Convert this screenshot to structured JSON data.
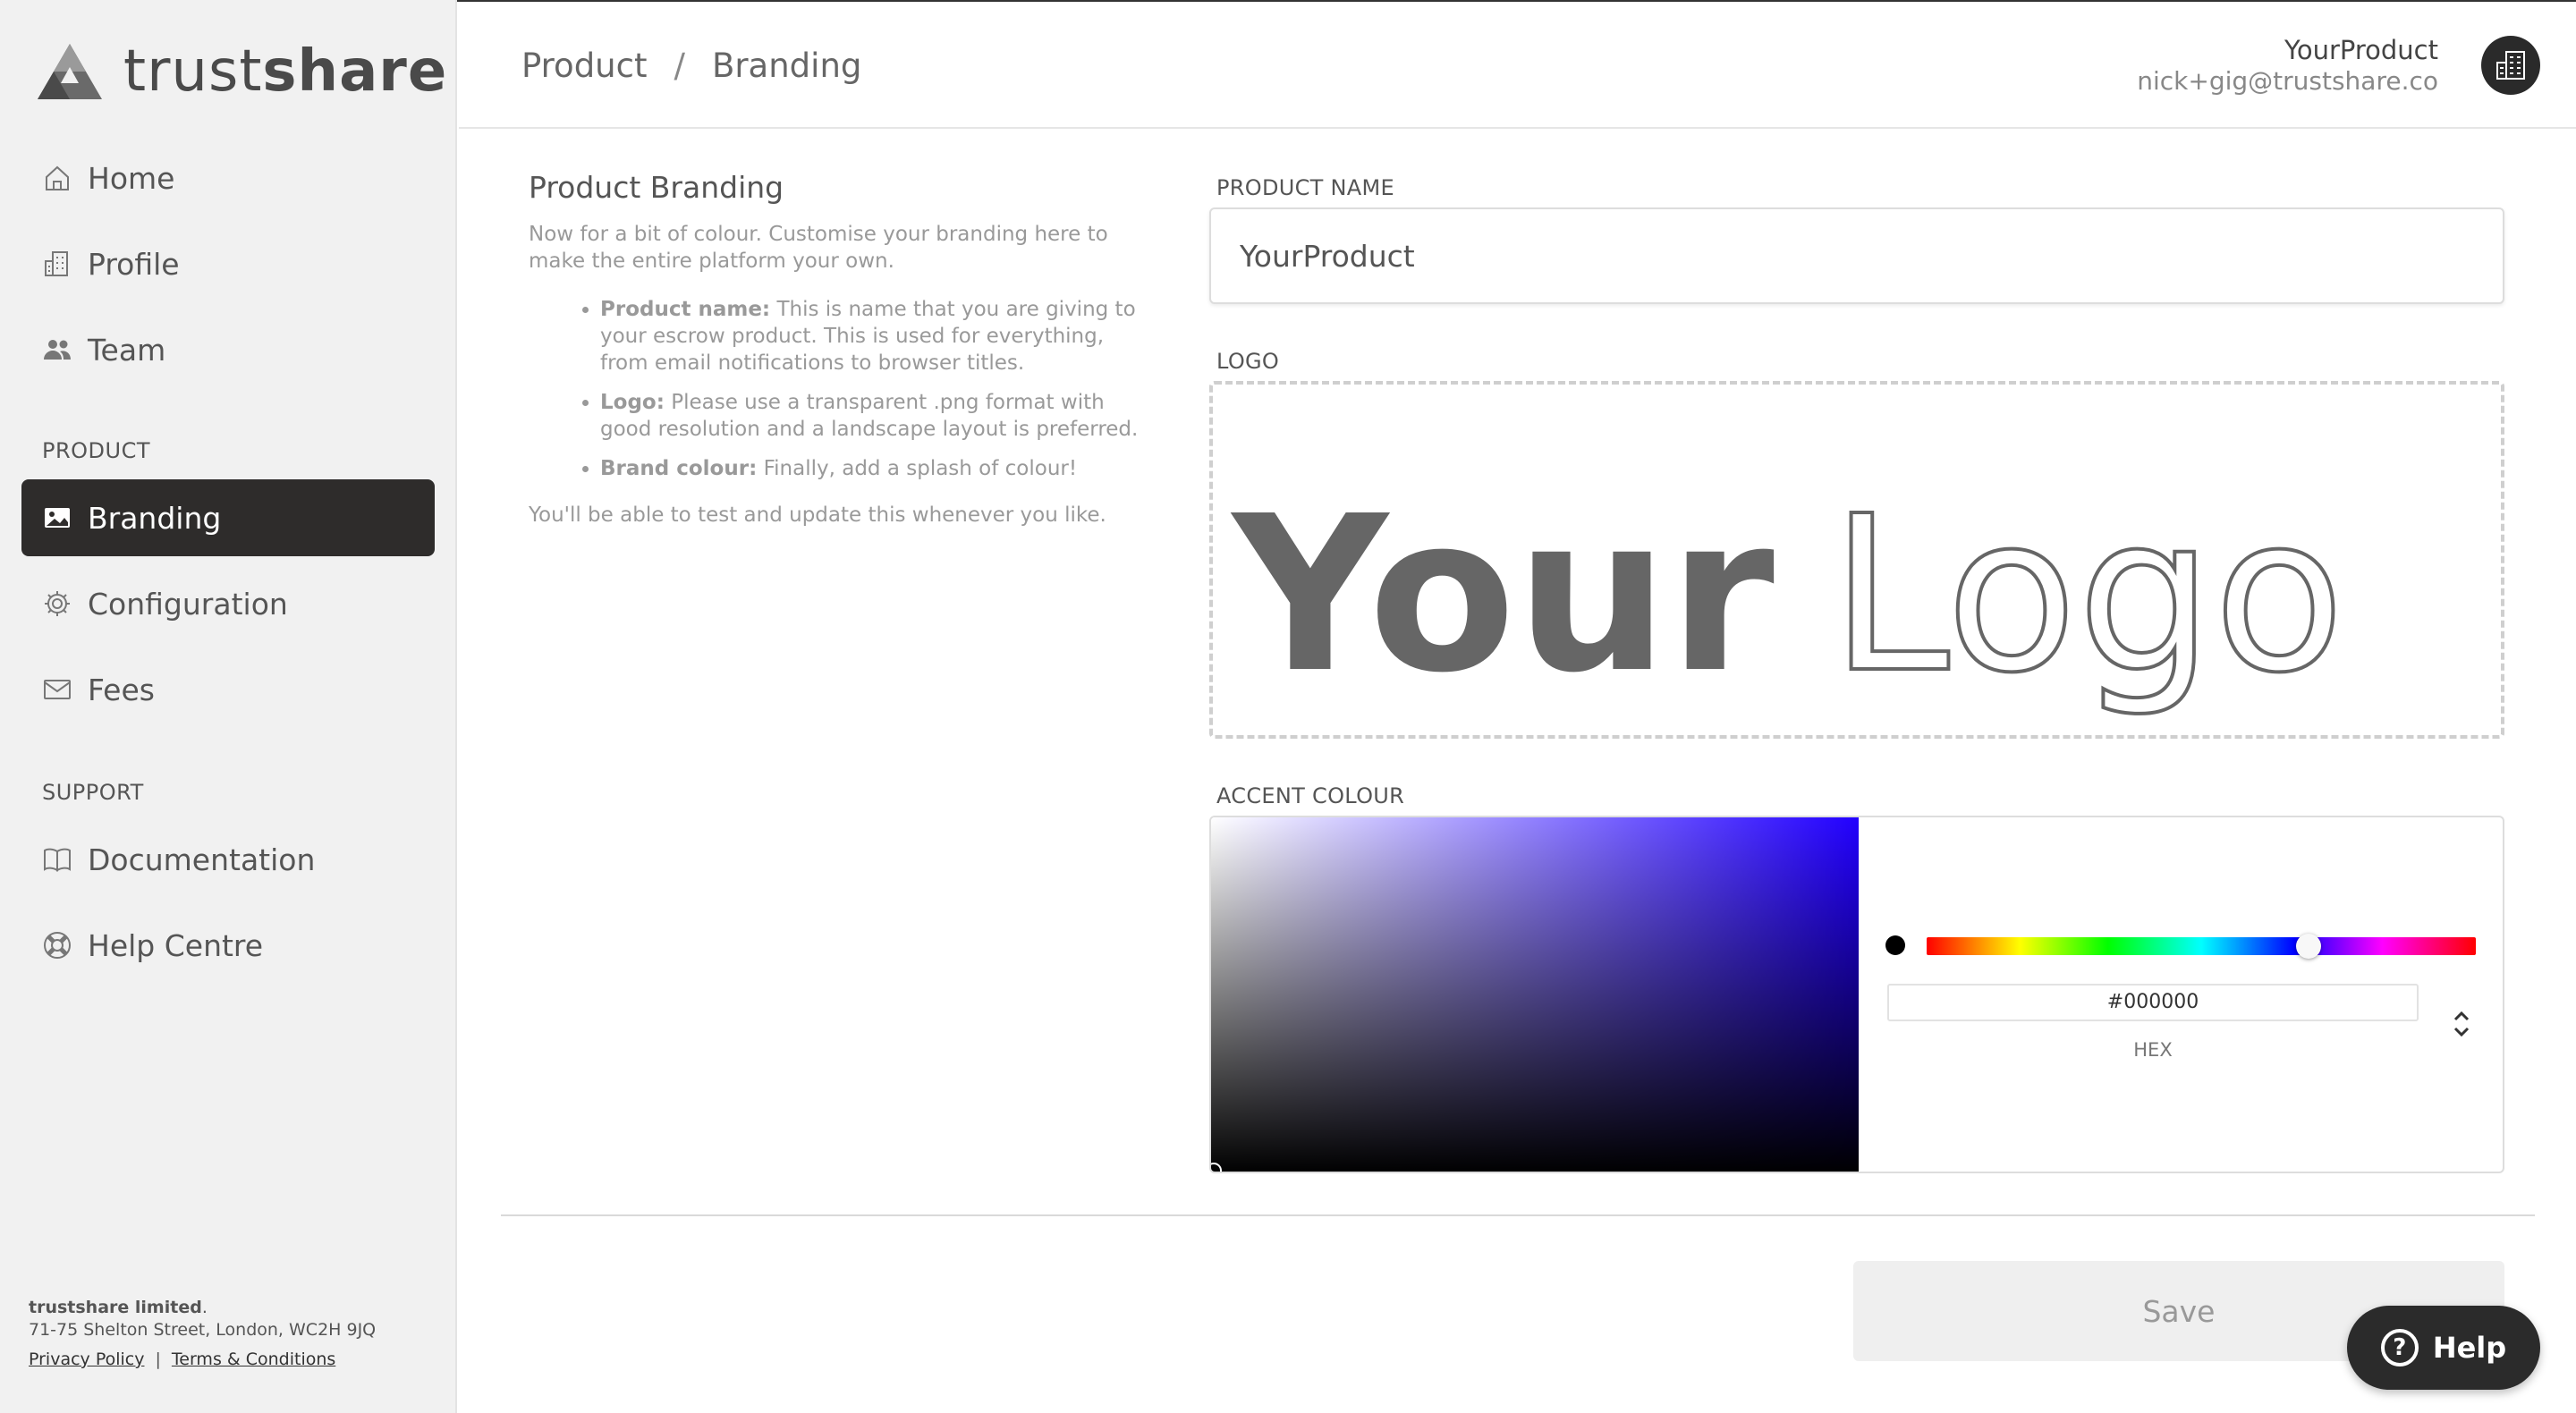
{
  "brand": {
    "name_light": "trust",
    "name_bold": "share"
  },
  "nav": {
    "home": "Home",
    "profile": "Profile",
    "team": "Team",
    "product_section": "PRODUCT",
    "branding": "Branding",
    "configuration": "Configuration",
    "fees": "Fees",
    "support_section": "SUPPORT",
    "documentation": "Documentation",
    "help_centre": "Help Centre"
  },
  "footer": {
    "company": "trustshare limited",
    "company_suffix": ".",
    "address": "71-75 Shelton Street, London, WC2H 9JQ",
    "privacy": "Privacy Policy",
    "separator": "|",
    "terms": "Terms & Conditions"
  },
  "header": {
    "crumb1": "Product",
    "crumb_sep": "/",
    "crumb2": "Branding",
    "user_product": "YourProduct",
    "user_email": "nick+gig@trustshare.co"
  },
  "description": {
    "title": "Product Branding",
    "intro": "Now for a bit of colour. Customise your branding here to make the entire platform your own.",
    "items": [
      {
        "term": "Product name:",
        "text": " This is name that you are giving to your escrow product. This is used for everything, from email notifications to browser titles."
      },
      {
        "term": "Logo:",
        "text": " Please use a transparent .png format with good resolution and a landscape layout is preferred."
      },
      {
        "term": "Brand colour:",
        "text": " Finally, add a splash of colour!"
      }
    ],
    "outro": "You'll be able to test and update this whenever you like."
  },
  "form": {
    "product_name_label": "PRODUCT NAME",
    "product_name_value": "YourProduct",
    "logo_label": "LOGO",
    "logo_text_bold": "Your",
    "logo_text_outline": "Logo",
    "accent_label": "ACCENT COLOUR",
    "hex_value": "#000000",
    "hex_label": "HEX",
    "hue_fraction": 0.695
  },
  "actions": {
    "save": "Save",
    "help": "Help"
  },
  "colors": {
    "sidebar_active": "#2e2c2b",
    "hue_base": "#2200ff",
    "help_bg": "#2b2b2b"
  }
}
